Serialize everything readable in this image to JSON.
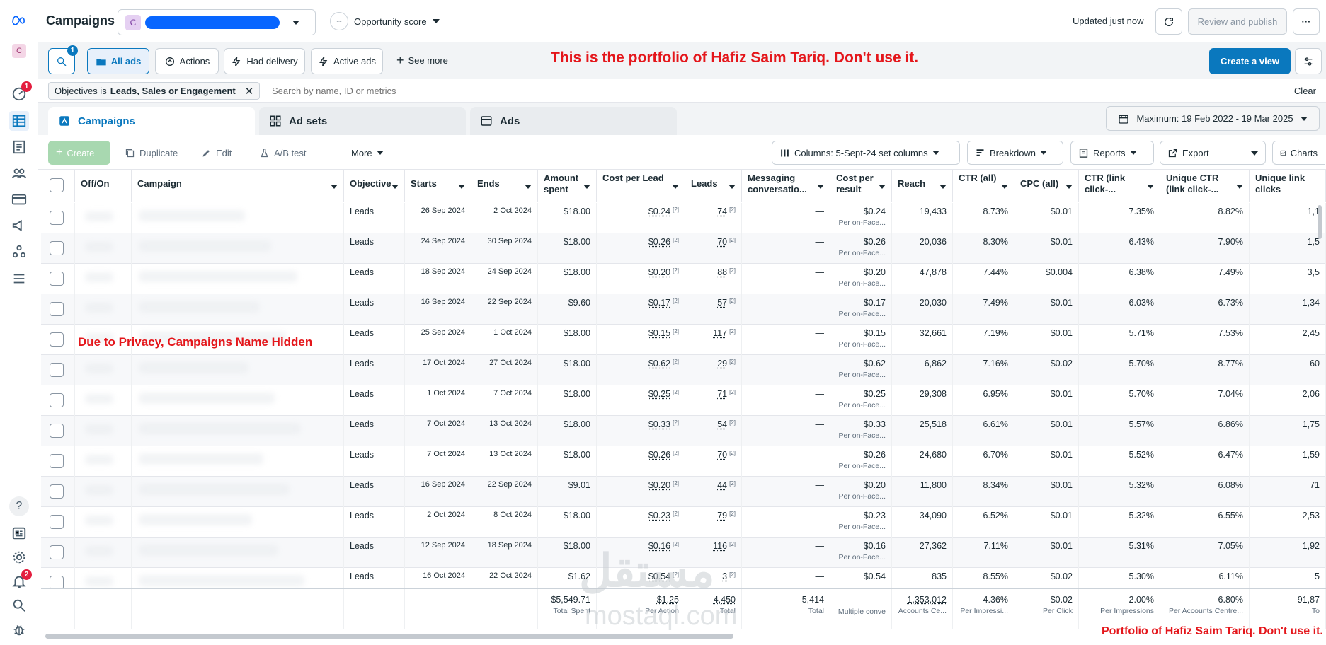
{
  "header": {
    "title": "Campaigns",
    "account_initial": "C",
    "opportunity_label": "Opportunity score",
    "opportunity_value": "--",
    "updated": "Updated just now",
    "review_publish": "Review and publish",
    "more": "···"
  },
  "rail": {
    "account_initial": "C",
    "badge_alerts": "1",
    "badge_notifications": "2"
  },
  "filters": {
    "search_badge": "1",
    "all_ads": "All ads",
    "actions": "Actions",
    "had_delivery": "Had delivery",
    "active_ads": "Active ads",
    "see_more": "See more",
    "create_view": "Create a view",
    "watermark_top": "This is the portfolio of Hafiz Saim Tariq. Don't use it.",
    "chip_prefix": "Objectives is",
    "chip_value": "Leads, Sales or Engagement",
    "search_placeholder": "Search by name, ID or metrics",
    "clear": "Clear"
  },
  "tabs": {
    "campaigns": "Campaigns",
    "adsets": "Ad sets",
    "ads": "Ads",
    "date_range": "Maximum: 19 Feb 2022 - 19 Mar 2025"
  },
  "toolbar": {
    "create": "Create",
    "duplicate": "Duplicate",
    "edit": "Edit",
    "ab_test": "A/B test",
    "more": "More",
    "columns": "Columns: 5-Sept-24 set columns",
    "breakdown": "Breakdown",
    "reports": "Reports",
    "export": "Export",
    "charts": "Charts"
  },
  "columns": {
    "onoff": "Off/On",
    "campaign": "Campaign",
    "objective": "Objective",
    "starts": "Starts",
    "ends": "Ends",
    "amount": "Amount spent",
    "cpl": "Cost per Lead",
    "leads": "Leads",
    "msg": "Messaging conversatio...",
    "cpr": "Cost per result",
    "reach": "Reach",
    "ctr": "CTR (all)",
    "cpc": "CPC (all)",
    "ctr_link": "CTR (link click-...",
    "unique_ctr": "Unique CTR (link click-...",
    "unique_link": "Unique link clicks"
  },
  "privacy_note": "Due to Privacy, Campaigns Name Hidden",
  "rows": [
    {
      "objective": "Leads",
      "starts": "26 Sep 2024",
      "ends": "2 Oct 2024",
      "amount": "$18.00",
      "cpl": "$0.24",
      "leads": "74",
      "msg": "—",
      "cpr": "$0.24",
      "cpr_sub": "Per on-Face...",
      "reach": "19,433",
      "ctr": "8.73%",
      "cpc": "$0.01",
      "ctr_link": "7.35%",
      "unique_ctr": "8.82%",
      "unique_link": "1,1"
    },
    {
      "objective": "Leads",
      "starts": "24 Sep 2024",
      "ends": "30 Sep 2024",
      "amount": "$18.00",
      "cpl": "$0.26",
      "leads": "70",
      "msg": "—",
      "cpr": "$0.26",
      "cpr_sub": "Per on-Face...",
      "reach": "20,036",
      "ctr": "8.30%",
      "cpc": "$0.01",
      "ctr_link": "6.43%",
      "unique_ctr": "7.90%",
      "unique_link": "1,5"
    },
    {
      "objective": "Leads",
      "starts": "18 Sep 2024",
      "ends": "24 Sep 2024",
      "amount": "$18.00",
      "cpl": "$0.20",
      "leads": "88",
      "msg": "—",
      "cpr": "$0.20",
      "cpr_sub": "Per on-Face...",
      "reach": "47,878",
      "ctr": "7.44%",
      "cpc": "$0.004",
      "ctr_link": "6.38%",
      "unique_ctr": "7.49%",
      "unique_link": "3,5"
    },
    {
      "objective": "Leads",
      "starts": "16 Sep 2024",
      "ends": "22 Sep 2024",
      "amount": "$9.60",
      "cpl": "$0.17",
      "leads": "57",
      "msg": "—",
      "cpr": "$0.17",
      "cpr_sub": "Per on-Face...",
      "reach": "20,030",
      "ctr": "7.49%",
      "cpc": "$0.01",
      "ctr_link": "6.03%",
      "unique_ctr": "6.73%",
      "unique_link": "1,34"
    },
    {
      "objective": "Leads",
      "starts": "25 Sep 2024",
      "ends": "1 Oct 2024",
      "amount": "$18.00",
      "cpl": "$0.15",
      "leads": "117",
      "msg": "—",
      "cpr": "$0.15",
      "cpr_sub": "Per on-Face...",
      "reach": "32,661",
      "ctr": "7.19%",
      "cpc": "$0.01",
      "ctr_link": "5.71%",
      "unique_ctr": "7.53%",
      "unique_link": "2,45"
    },
    {
      "objective": "Leads",
      "starts": "17 Oct 2024",
      "ends": "27 Oct 2024",
      "amount": "$18.00",
      "cpl": "$0.62",
      "leads": "29",
      "msg": "—",
      "cpr": "$0.62",
      "cpr_sub": "Per on-Face...",
      "reach": "6,862",
      "ctr": "7.16%",
      "cpc": "$0.02",
      "ctr_link": "5.70%",
      "unique_ctr": "8.77%",
      "unique_link": "60"
    },
    {
      "objective": "Leads",
      "starts": "1 Oct 2024",
      "ends": "7 Oct 2024",
      "amount": "$18.00",
      "cpl": "$0.25",
      "leads": "71",
      "msg": "—",
      "cpr": "$0.25",
      "cpr_sub": "Per on-Face...",
      "reach": "29,308",
      "ctr": "6.95%",
      "cpc": "$0.01",
      "ctr_link": "5.70%",
      "unique_ctr": "7.04%",
      "unique_link": "2,06"
    },
    {
      "objective": "Leads",
      "starts": "7 Oct 2024",
      "ends": "13 Oct 2024",
      "amount": "$18.00",
      "cpl": "$0.33",
      "leads": "54",
      "msg": "—",
      "cpr": "$0.33",
      "cpr_sub": "Per on-Face...",
      "reach": "25,518",
      "ctr": "6.61%",
      "cpc": "$0.01",
      "ctr_link": "5.57%",
      "unique_ctr": "6.86%",
      "unique_link": "1,75"
    },
    {
      "objective": "Leads",
      "starts": "7 Oct 2024",
      "ends": "13 Oct 2024",
      "amount": "$18.00",
      "cpl": "$0.26",
      "leads": "70",
      "msg": "—",
      "cpr": "$0.26",
      "cpr_sub": "Per on-Face...",
      "reach": "24,680",
      "ctr": "6.70%",
      "cpc": "$0.01",
      "ctr_link": "5.52%",
      "unique_ctr": "6.47%",
      "unique_link": "1,59"
    },
    {
      "objective": "Leads",
      "starts": "16 Sep 2024",
      "ends": "22 Sep 2024",
      "amount": "$9.01",
      "cpl": "$0.20",
      "leads": "44",
      "msg": "—",
      "cpr": "$0.20",
      "cpr_sub": "Per on-Face...",
      "reach": "11,800",
      "ctr": "8.34%",
      "cpc": "$0.01",
      "ctr_link": "5.32%",
      "unique_ctr": "6.08%",
      "unique_link": "71"
    },
    {
      "objective": "Leads",
      "starts": "2 Oct 2024",
      "ends": "8 Oct 2024",
      "amount": "$18.00",
      "cpl": "$0.23",
      "leads": "79",
      "msg": "—",
      "cpr": "$0.23",
      "cpr_sub": "Per on-Face...",
      "reach": "34,090",
      "ctr": "6.52%",
      "cpc": "$0.01",
      "ctr_link": "5.32%",
      "unique_ctr": "6.55%",
      "unique_link": "2,53"
    },
    {
      "objective": "Leads",
      "starts": "12 Sep 2024",
      "ends": "18 Sep 2024",
      "amount": "$18.00",
      "cpl": "$0.16",
      "leads": "116",
      "msg": "—",
      "cpr": "$0.16",
      "cpr_sub": "Per on-Face...",
      "reach": "27,362",
      "ctr": "7.11%",
      "cpc": "$0.01",
      "ctr_link": "5.31%",
      "unique_ctr": "7.05%",
      "unique_link": "1,92"
    },
    {
      "objective": "Leads",
      "starts": "16 Oct 2024",
      "ends": "22 Oct 2024",
      "amount": "$1.62",
      "cpl": "$0.54",
      "leads": "3",
      "msg": "—",
      "cpr": "$0.54",
      "cpr_sub": "",
      "reach": "835",
      "ctr": "8.55%",
      "cpc": "$0.02",
      "ctr_link": "5.30%",
      "unique_ctr": "6.11%",
      "unique_link": "5"
    }
  ],
  "totals": {
    "amount": "$5,549.71",
    "amount_sub": "Total Spent",
    "cpl": "$1.25",
    "cpl_sub": "Per Action",
    "leads": "4,450",
    "leads_sub": "Total",
    "msg": "5,414",
    "msg_sub": "Total",
    "cpr_sub": "Multiple conve",
    "reach": "1,353,012",
    "reach_sub": "Accounts Ce...",
    "ctr": "4.36%",
    "ctr_sub": "Per Impressi...",
    "cpc": "$0.02",
    "cpc_sub": "Per Click",
    "ctr_link": "2.00%",
    "ctr_link_sub": "Per Impressions",
    "unique_ctr": "6.80%",
    "unique_ctr_sub": "Per Accounts Centre...",
    "unique_link": "91,87",
    "unique_link_sub": "To"
  },
  "watermark_bottom": "Portfolio of Hafiz Saim Tariq. Don't use it.",
  "mostaql": "مستقل",
  "mostaql_latin": "mostaql.com"
}
